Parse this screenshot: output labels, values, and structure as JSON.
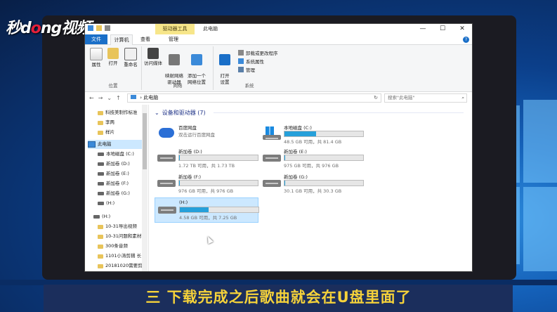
{
  "watermark": {
    "pre": "秒",
    "mid": "d",
    "o": "o",
    "post": "ng视频"
  },
  "titlebar": {
    "context_tab": "驱动器工具",
    "title": "此电脑",
    "minimize": "—",
    "maximize": "☐",
    "close": "✕"
  },
  "tabs": {
    "file": "文件",
    "computer": "计算机",
    "view": "查看",
    "manage": "管理",
    "help": "?"
  },
  "ribbon": {
    "location_group": {
      "label": "位置",
      "buttons": [
        "属性",
        "打开",
        "重命名"
      ]
    },
    "network_group": {
      "label": "网络",
      "buttons": [
        "访问媒体",
        "映射网络\n驱动器",
        "添加一个\n网络位置"
      ]
    },
    "system_group": {
      "label": "系统",
      "open_settings": "打开\n设置",
      "items": [
        "卸载或更改程序",
        "系统属性",
        "管理"
      ]
    }
  },
  "address": {
    "path": "此电脑",
    "search_placeholder": "搜索\"此电脑\""
  },
  "nav_items": [
    {
      "label": "科技美制作标准",
      "type": "folder"
    },
    {
      "label": "李两",
      "type": "folder"
    },
    {
      "label": "样片",
      "type": "folder"
    },
    {
      "label": "此电脑",
      "type": "pc"
    },
    {
      "label": "本地磁盘 (C:)",
      "type": "drive"
    },
    {
      "label": "新加卷 (D:)",
      "type": "drive"
    },
    {
      "label": "新加卷 (E:)",
      "type": "drive"
    },
    {
      "label": "新加卷 (F:)",
      "type": "drive"
    },
    {
      "label": "新加卷 (G:)",
      "type": "drive"
    },
    {
      "label": "(H:)",
      "type": "drive"
    },
    {
      "label": "(H:)",
      "type": "drive"
    },
    {
      "label": "10-31导出视频",
      "type": "folder"
    },
    {
      "label": "10-31问题和素材",
      "type": "folder"
    },
    {
      "label": "300条音频",
      "type": "folder"
    },
    {
      "label": "1101小涛剪辑 长",
      "type": "folder"
    },
    {
      "label": "20181020需要剪",
      "type": "folder"
    }
  ],
  "group_header": "设备和驱动器 (7)",
  "devices": [
    {
      "name": "百度网盘",
      "caption": "双击运行百度网盘",
      "used": null
    },
    {
      "name": "本地磁盘 (C:)",
      "caption": "48.5 GB 可用，共 81.4 GB",
      "used": 0.4
    },
    {
      "name": "新加卷 (D:)",
      "caption": "1.72 TB 可用，共 1.73 TB",
      "used": 0.01
    },
    {
      "name": "新加卷 (E:)",
      "caption": "975 GB 可用，共 976 GB",
      "used": 0.01
    },
    {
      "name": "新加卷 (F:)",
      "caption": "976 GB 可用，共 976 GB",
      "used": 0.0
    },
    {
      "name": "新加卷 (G:)",
      "caption": "30.1 GB 可用，共 30.3 GB",
      "used": 0.01
    },
    {
      "name": "(H:)",
      "caption": "4.58 GB 可用，共 7.25 GB",
      "used": 0.37
    }
  ],
  "subtitle": "三  下载完成之后歌曲就会在U盘里面了",
  "colors": {
    "accent": "#1a6fc8",
    "selection": "#cce8ff",
    "progress": "#26a0da",
    "subtitle": "#f5d23a"
  }
}
